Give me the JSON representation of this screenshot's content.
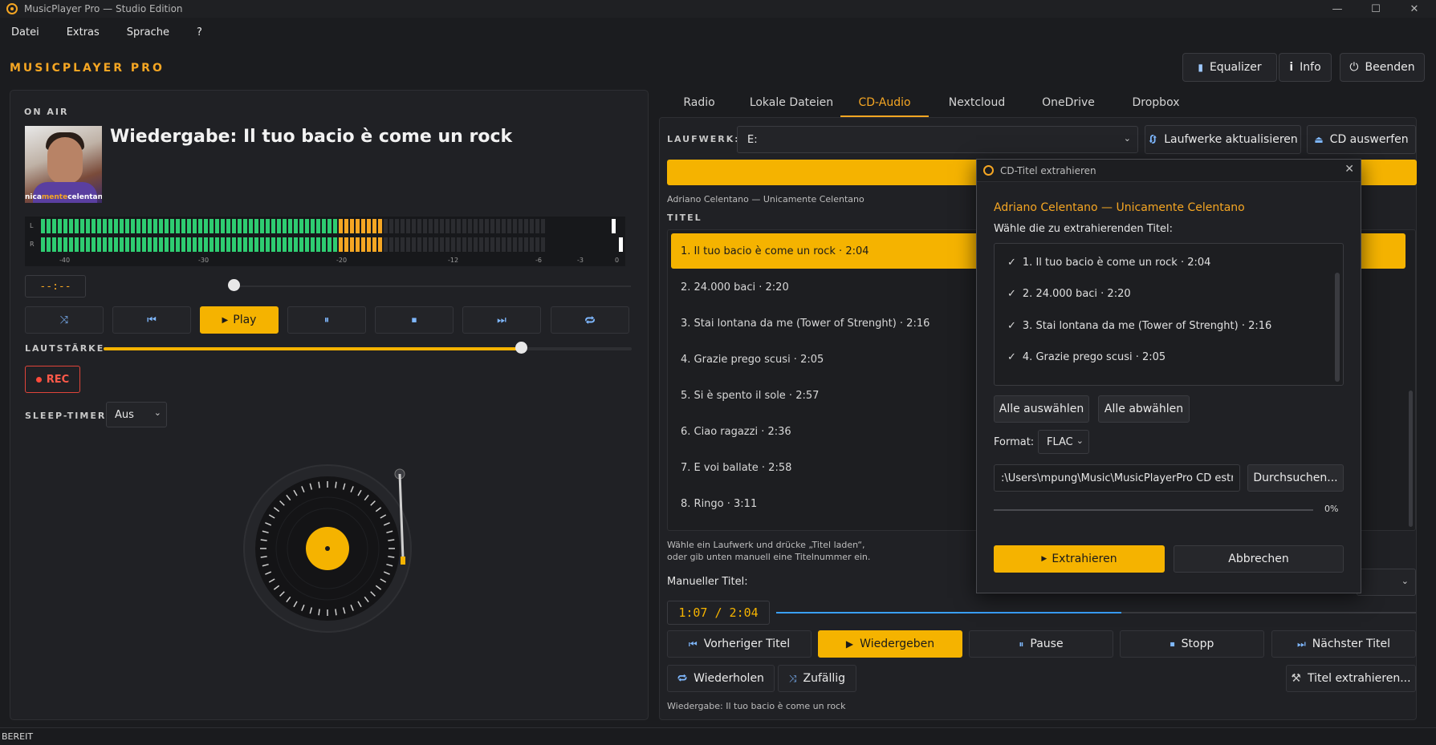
{
  "window": {
    "title": "MusicPlayer Pro — Studio Edition",
    "minimize": "—",
    "maximize": "☐",
    "close": "✕"
  },
  "menu": [
    "Datei",
    "Extras",
    "Sprache",
    "?"
  ],
  "header": {
    "brand": "MUSICPLAYER PRO",
    "equalizer": "Equalizer",
    "info": "Info",
    "quit": "Beenden"
  },
  "player": {
    "on_air": "ON AIR",
    "cover_text_a": "nica",
    "cover_text_b": "mente",
    "cover_text_c": "celentano",
    "now_playing": "Wiedergabe: Il tuo bacio è come un rock",
    "vu": {
      "left_label": "L",
      "right_label": "R",
      "scale": [
        "-40",
        "-30",
        "-20",
        "-12",
        "-6",
        "-3",
        "0"
      ],
      "level_left_fraction": 0.68,
      "level_right_fraction": 0.68
    },
    "time": "--:--",
    "seek_fraction": 0.0,
    "play": "Play",
    "volume_label": "LAUTSTÄRKE",
    "volume_fraction": 0.79,
    "rec": "REC",
    "sleep_label": "SLEEP-TIMER",
    "sleep_value": "Aus"
  },
  "tabs": [
    "Radio",
    "Lokale Dateien",
    "CD-Audio",
    "Nextcloud",
    "OneDrive",
    "Dropbox"
  ],
  "active_tab": "CD-Audio",
  "cd": {
    "drive_label": "LAUFWERK:",
    "drive_value": "E:",
    "refresh": "Laufwerke aktualisieren",
    "eject": "CD auswerfen",
    "album": "Adriano Celentano — Unicamente Celentano",
    "titles_label": "TITEL",
    "tracks": [
      "1. Il tuo bacio è come un rock  ·  2:04",
      "2. 24.000 baci  ·  2:20",
      "3. Stai lontana da me (Tower of Strenght)  ·  2:16",
      "4. Grazie prego scusi  ·  2:05",
      "5. Si è spento il sole  ·  2:57",
      "6. Ciao ragazzi  ·  2:36",
      "7. E voi ballate  ·  2:58",
      "8. Ringo  ·  3:11"
    ],
    "hint_line1": "Wähle ein Laufwerk und drücke „Titel laden“,",
    "hint_line2": "oder gib unten manuell eine Titelnummer ein.",
    "manual_label": "Manueller Titel:",
    "time": "1:07 / 2:04",
    "progress_fraction": 0.54,
    "prev": "Vorheriger Titel",
    "play": "Wiedergeben",
    "pause": "Pause",
    "stop": "Stopp",
    "next": "Nächster Titel",
    "repeat": "Wiederholen",
    "shuffle": "Zufällig",
    "extract": "Titel extrahieren...",
    "status": "Wiedergabe: Il tuo bacio è come un rock"
  },
  "dialog": {
    "title": "CD-Titel extrahieren",
    "album": "Adriano Celentano — Unicamente Celentano",
    "prompt": "Wähle die zu extrahierenden Titel:",
    "items": [
      "1. Il tuo bacio è come un rock  ·  2:04",
      "2. 24.000 baci  ·  2:20",
      "3. Stai lontana da me (Tower of Strenght)  ·  2:16",
      "4. Grazie prego scusi  ·  2:05"
    ],
    "select_all": "Alle auswählen",
    "deselect_all": "Alle abwählen",
    "format_label": "Format:",
    "format_value": "FLAC",
    "path": ":\\Users\\mpung\\Music\\MusicPlayerPro CD estratti",
    "browse": "Durchsuchen...",
    "percent": "0%",
    "extract": "Extrahieren",
    "cancel": "Abbrechen"
  },
  "statusbar": "BEREIT",
  "colors": {
    "accent": "#f5b300",
    "vu_green": "#2ecc71",
    "vu_amber": "#f5a623",
    "rec_red": "#ff4a3a"
  }
}
